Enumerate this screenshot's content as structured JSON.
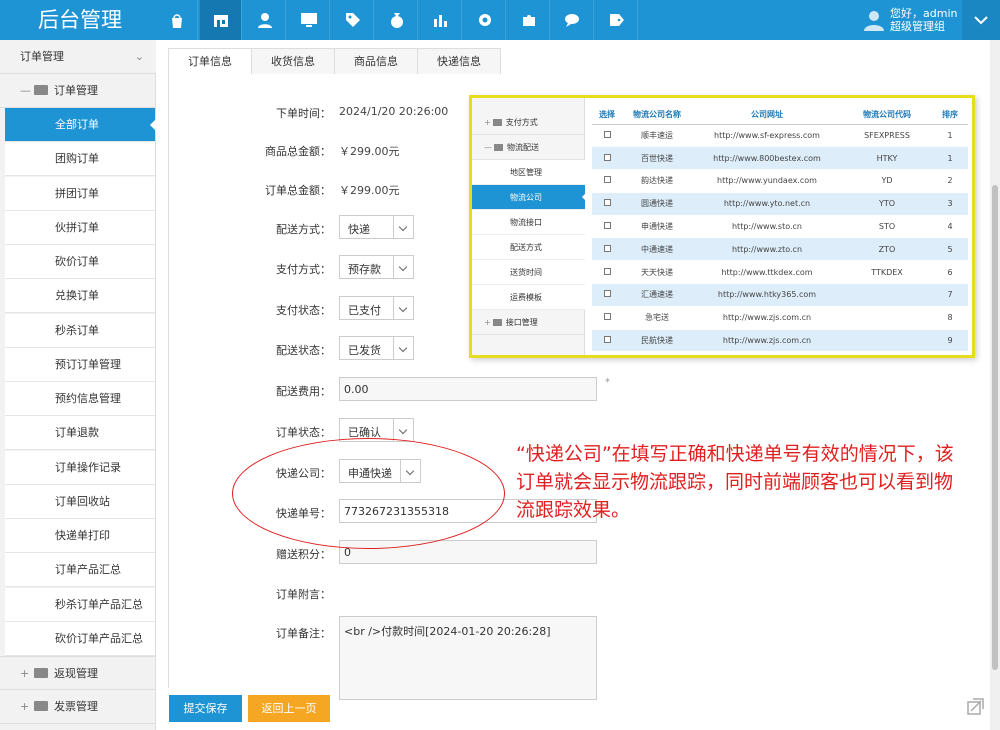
{
  "header": {
    "brand": "后台管理",
    "nav_icons": [
      "shopping-bag-icon",
      "store-icon",
      "user-icon",
      "monitor-icon",
      "tag-icon",
      "money-bag-icon",
      "bar-chart-icon",
      "gear-icon",
      "puzzle-icon",
      "chat-icon",
      "label-icon"
    ],
    "user_greeting": "您好，admin",
    "user_role": "超级管理组"
  },
  "sidebar": {
    "section_title": "订单管理",
    "group_title": "订单管理",
    "items": [
      "全部订单",
      "团购订单",
      "拼团订单",
      "伙拼订单",
      "砍价订单",
      "兑换订单",
      "秒杀订单",
      "预订订单管理",
      "预约信息管理",
      "订单退款",
      "订单操作记录",
      "订单回收站",
      "快递单打印",
      "订单产品汇总",
      "秒杀订单产品汇总",
      "砍价订单产品汇总"
    ],
    "active_index": 0,
    "collapsed_groups": [
      "返现管理",
      "发票管理"
    ]
  },
  "tabs": [
    "订单信息",
    "收货信息",
    "商品信息",
    "快递信息"
  ],
  "form": {
    "order_time": {
      "label": "下单时间：",
      "value": "2024/1/20 20:26:00"
    },
    "goods_total": {
      "label": "商品总金额：",
      "value": "￥299.00元"
    },
    "order_total": {
      "label": "订单总金额：",
      "value": "￥299.00元"
    },
    "delivery_method": {
      "label": "配送方式：",
      "value": "快递"
    },
    "payment_method": {
      "label": "支付方式：",
      "value": "预存款"
    },
    "payment_status": {
      "label": "支付状态：",
      "value": "已支付"
    },
    "delivery_status": {
      "label": "配送状态：",
      "value": "已发货"
    },
    "delivery_fee": {
      "label": "配送费用：",
      "value": "0.00",
      "suffix": "*"
    },
    "order_status": {
      "label": "订单状态：",
      "value": "已确认"
    },
    "express_company": {
      "label": "快递公司：",
      "value": "申通快递"
    },
    "tracking_no": {
      "label": "快递单号：",
      "value": "773267231355318"
    },
    "bonus_points": {
      "label": "赠送积分：",
      "value": "0"
    },
    "order_attachment": {
      "label": "订单附言：",
      "value": ""
    },
    "order_remark": {
      "label": "订单备注：",
      "value": "<br />付款时间[2024-01-20 20:26:28]"
    }
  },
  "buttons": {
    "submit": "提交保存",
    "back": "返回上一页"
  },
  "inset": {
    "sidebar": {
      "group_top": "支付方式",
      "group_open": "物流配送",
      "items": [
        "地区管理",
        "物流公司",
        "物流接口",
        "配送方式",
        "送货时间",
        "运费模板"
      ],
      "active_index": 1,
      "group_bottom": "接口管理"
    },
    "columns": [
      "选择",
      "物流公司名称",
      "公司网址",
      "物流公司代码",
      "排序"
    ],
    "rows": [
      {
        "name": "顺丰速运",
        "url": "http://www.sf-express.com",
        "code": "SFEXPRESS",
        "sort": "1"
      },
      {
        "name": "百世快递",
        "url": "http://www.800bestex.com",
        "code": "HTKY",
        "sort": "1"
      },
      {
        "name": "韵达快递",
        "url": "http://www.yundaex.com",
        "code": "YD",
        "sort": "2"
      },
      {
        "name": "圆通快递",
        "url": "http://www.yto.net.cn",
        "code": "YTO",
        "sort": "3"
      },
      {
        "name": "申通快递",
        "url": "http://www.sto.cn",
        "code": "STO",
        "sort": "4"
      },
      {
        "name": "中通速递",
        "url": "http://www.zto.cn",
        "code": "ZTO",
        "sort": "5"
      },
      {
        "name": "天天快递",
        "url": "http://www.ttkdex.com",
        "code": "TTKDEX",
        "sort": "6"
      },
      {
        "name": "汇通速递",
        "url": "http://www.htky365.com",
        "code": "",
        "sort": "7"
      },
      {
        "name": "急宅送",
        "url": "http://www.zjs.com.cn",
        "code": "",
        "sort": "8"
      },
      {
        "name": "民航快递",
        "url": "http://www.zjs.com.cn",
        "code": "",
        "sort": "9"
      }
    ]
  },
  "annotation": {
    "text": "“快递公司”在填写正确和快递单号有效的情况下，该订单就会显示物流跟踪，同时前端顾客也可以看到物流跟踪效果。"
  },
  "colors": {
    "primary": "#1f94d4",
    "orange": "#f5a623",
    "annotation": "#e02020",
    "highlight_border": "#e6dd1e"
  }
}
